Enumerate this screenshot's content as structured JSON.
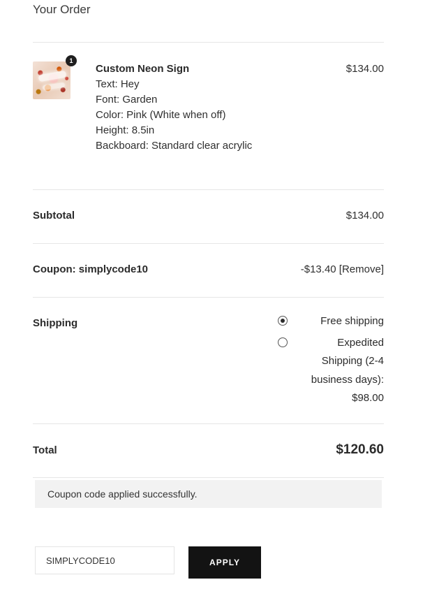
{
  "order": {
    "title": "Your Order"
  },
  "product": {
    "quantity": "1",
    "name": "Custom Neon Sign",
    "price": "$134.00",
    "details": [
      "Text: Hey",
      "Font: Garden",
      "Color: Pink (White when off)",
      "Height: 8.5in",
      "Backboard: Standard clear acrylic"
    ]
  },
  "subtotal": {
    "label": "Subtotal",
    "value": "$134.00"
  },
  "coupon": {
    "label": "Coupon: simplycode10",
    "amount": "-$13.40",
    "remove_label": "[Remove]"
  },
  "shipping": {
    "label": "Shipping",
    "options": [
      {
        "label": "Free shipping",
        "selected": true
      },
      {
        "label": "Expedited Shipping (2-4 business days): $98.00",
        "selected": false
      }
    ]
  },
  "total": {
    "label": "Total",
    "value": "$120.60"
  },
  "notice": {
    "message": "Coupon code applied successfully."
  },
  "coupon_form": {
    "input_value": "SIMPLYCODE10",
    "apply_label": "APPLY"
  }
}
